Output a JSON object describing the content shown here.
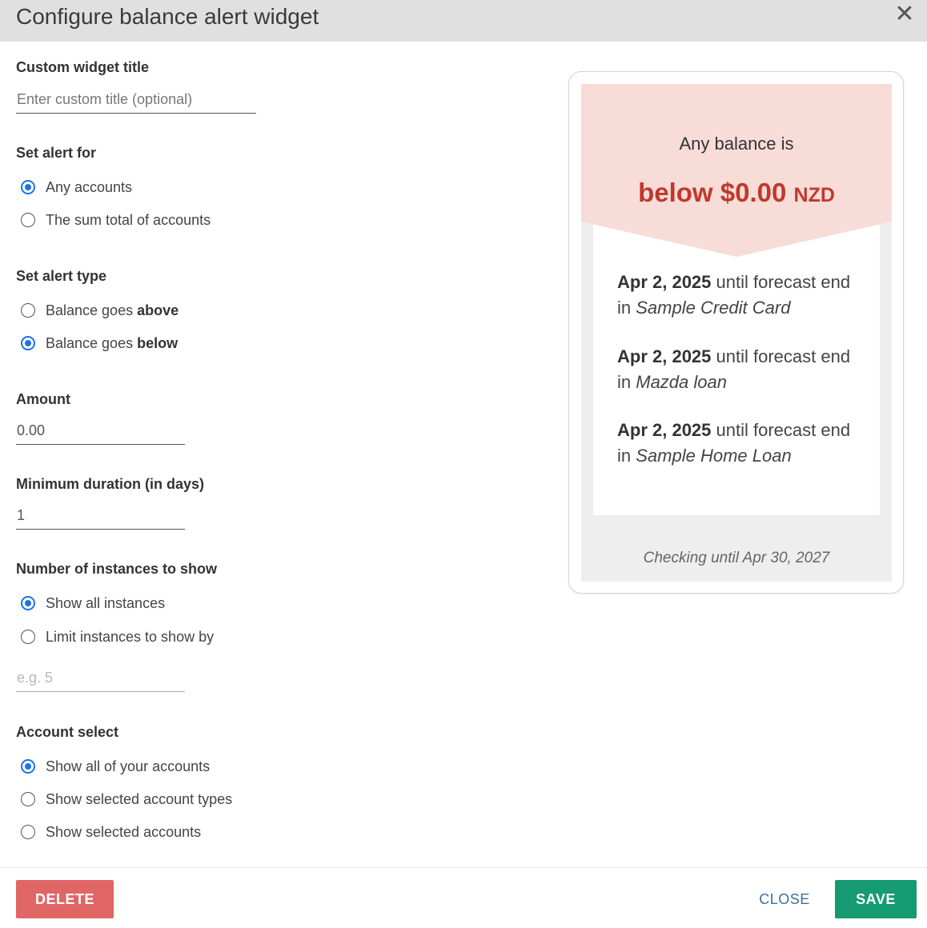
{
  "dialog": {
    "title": "Configure balance alert widget"
  },
  "form": {
    "custom_title": {
      "label": "Custom widget title",
      "placeholder": "Enter custom title (optional)",
      "value": ""
    },
    "alert_for": {
      "label": "Set alert for",
      "options": [
        {
          "label": "Any accounts",
          "checked": true
        },
        {
          "label": "The sum total of accounts",
          "checked": false
        }
      ]
    },
    "alert_type": {
      "label": "Set alert type",
      "options": [
        {
          "prefix": "Balance goes",
          "emph": "above",
          "checked": false
        },
        {
          "prefix": "Balance goes",
          "emph": "below",
          "checked": true
        }
      ]
    },
    "amount": {
      "label": "Amount",
      "value": "0.00"
    },
    "min_duration": {
      "label": "Minimum duration (in days)",
      "value": "1"
    },
    "instances": {
      "label": "Number of instances to show",
      "options": [
        {
          "label": "Show all instances",
          "checked": true
        },
        {
          "label": "Limit instances to show by",
          "checked": false
        }
      ],
      "limit_placeholder": "e.g. 5"
    },
    "account_select": {
      "label": "Account select",
      "options": [
        {
          "label": "Show all of your accounts",
          "checked": true
        },
        {
          "label": "Show selected account types",
          "checked": false
        },
        {
          "label": "Show selected accounts",
          "checked": false
        }
      ]
    }
  },
  "preview": {
    "heading": "Any balance is",
    "amount_text": "below $0.00",
    "currency": "NZD",
    "instances": [
      {
        "date": "Apr 2, 2025",
        "middle": "until forecast end in",
        "account": "Sample Credit Card"
      },
      {
        "date": "Apr 2, 2025",
        "middle": "until forecast end in",
        "account": "Mazda loan"
      },
      {
        "date": "Apr 2, 2025",
        "middle": "until forecast end in",
        "account": "Sample Home Loan"
      }
    ],
    "checking": "Checking until Apr 30, 2027"
  },
  "footer": {
    "delete_label": "DELETE",
    "close_label": "CLOSE",
    "save_label": "SAVE"
  },
  "colors": {
    "accent_radio": "#1a73e8",
    "alert_red": "#c0392b",
    "alert_banner": "#f7dcd8",
    "delete_button": "#e06666",
    "save_button": "#159a72",
    "close_link": "#3d6f9a"
  }
}
